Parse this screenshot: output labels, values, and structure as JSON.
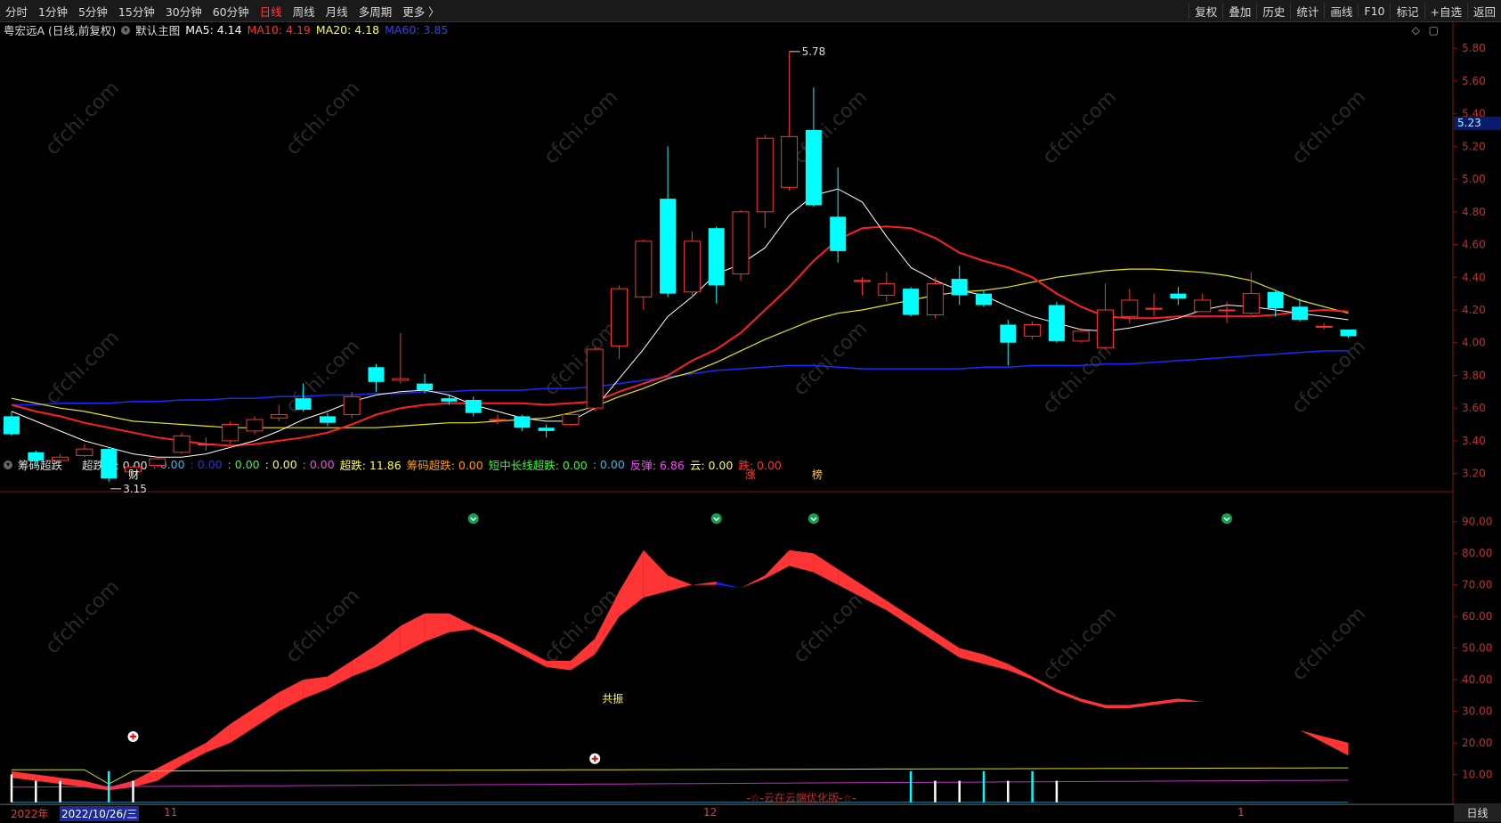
{
  "toolbar": {
    "periods": [
      "分时",
      "1分钟",
      "5分钟",
      "15分钟",
      "30分钟",
      "60分钟",
      "日线",
      "周线",
      "月线",
      "多周期",
      "更多 〉"
    ],
    "active_period": "日线",
    "right_buttons": [
      "复权",
      "叠加",
      "历史",
      "统计",
      "画线",
      "F10",
      "标记",
      "+自选",
      "返回"
    ]
  },
  "main_info": {
    "stock": "粤宏远A (日线,前复权)",
    "template": "默认主图",
    "ma5": "MA5: 4.14",
    "ma10": "MA10: 4.19",
    "ma20": "MA20: 4.18",
    "ma60": "MA60: 3.85"
  },
  "sub_info": {
    "name": "筹码超跌",
    "items": [
      {
        "text": "超跌柱: 0.00",
        "color": "#dddddd"
      },
      {
        "text": ": 0.00",
        "color": "#20c0ff"
      },
      {
        "text": ": 0.00",
        "color": "#2030ff"
      },
      {
        "text": ": 0.00",
        "color": "#30ff30"
      },
      {
        "text": ": 0.00",
        "color": "#ffff40"
      },
      {
        "text": ": 0.00",
        "color": "#ff40ff"
      },
      {
        "text": "超跌: 11.86",
        "color": "#ffff40"
      },
      {
        "text": "筹码超跌: 0.00",
        "color": "#ff9a00"
      },
      {
        "text": "短中长线超跌: 0.00",
        "color": "#30ff30"
      },
      {
        "text": ": 0.00",
        "color": "#20c0ff"
      },
      {
        "text": "反弹: 6.86",
        "color": "#ff40ff"
      },
      {
        "text": "云: 0.00",
        "color": "#ffff40"
      },
      {
        "text": "跌: 0.00",
        "color": "#ff3030"
      }
    ]
  },
  "colors": {
    "up": "#ff3232",
    "down": "#00ffff",
    "ma5": "#ffffff",
    "ma10": "#ff2020",
    "ma20": "#e8e800",
    "ma60": "#1a2aff",
    "axis": "#8a1010",
    "band_up": "#ff3535",
    "band_down": "#1a1aff"
  },
  "price_axis": {
    "min": 3.1,
    "max": 5.85,
    "labels": [
      "5.80",
      "5.60",
      "5.40",
      "5.20",
      "5.00",
      "4.80",
      "4.60",
      "4.40",
      "4.20",
      "4.00",
      "3.80",
      "3.60",
      "3.40",
      "3.20"
    ]
  },
  "current_price": "5.23",
  "sub_axis": {
    "min": 0,
    "max": 95,
    "labels": [
      "90.00",
      "80.00",
      "70.00",
      "60.00",
      "50.00",
      "40.00",
      "30.00",
      "20.00",
      "10.00"
    ]
  },
  "annotations": {
    "high": "5.78",
    "low": "3.15",
    "cai": "财",
    "zhang": "涨",
    "bang": "榜",
    "gongzhen": "共振",
    "watermark": "cfchi.com",
    "footer": "-☆-云在云端优化版-☆-"
  },
  "dates": {
    "year": "2022年",
    "cursor": "2022/10/26/三",
    "m11": "11",
    "m12": "12",
    "m1": "1"
  },
  "period_tag": "日线",
  "candles": [
    [
      3.55,
      3.44,
      3.58,
      3.43
    ],
    [
      3.33,
      3.28,
      3.34,
      3.24
    ],
    [
      3.28,
      3.3,
      3.32,
      3.27
    ],
    [
      3.31,
      3.35,
      3.38,
      3.3
    ],
    [
      3.35,
      3.17,
      3.36,
      3.15
    ],
    [
      3.21,
      3.24,
      3.25,
      3.19
    ],
    [
      3.25,
      3.29,
      3.3,
      3.24
    ],
    [
      3.33,
      3.43,
      3.45,
      3.32
    ],
    [
      3.38,
      3.38,
      3.42,
      3.34
    ],
    [
      3.4,
      3.5,
      3.52,
      3.38
    ],
    [
      3.46,
      3.53,
      3.55,
      3.44
    ],
    [
      3.54,
      3.56,
      3.62,
      3.52
    ],
    [
      3.66,
      3.59,
      3.75,
      3.58
    ],
    [
      3.55,
      3.51,
      3.57,
      3.49
    ],
    [
      3.56,
      3.67,
      3.7,
      3.54
    ],
    [
      3.85,
      3.76,
      3.87,
      3.7
    ],
    [
      3.77,
      3.78,
      4.06,
      3.75
    ],
    [
      3.75,
      3.71,
      3.81,
      3.69
    ],
    [
      3.66,
      3.64,
      3.68,
      3.62
    ],
    [
      3.65,
      3.57,
      3.67,
      3.55
    ],
    [
      3.53,
      3.53,
      3.56,
      3.5
    ],
    [
      3.55,
      3.48,
      3.56,
      3.46
    ],
    [
      3.48,
      3.46,
      3.5,
      3.42
    ],
    [
      3.5,
      3.56,
      3.58,
      3.49
    ],
    [
      3.6,
      3.96,
      3.97,
      3.58
    ],
    [
      3.98,
      4.33,
      4.35,
      3.9
    ],
    [
      4.28,
      4.62,
      4.63,
      4.2
    ],
    [
      4.88,
      4.3,
      5.2,
      4.28
    ],
    [
      4.31,
      4.62,
      4.68,
      4.27
    ],
    [
      4.7,
      4.35,
      4.71,
      4.24
    ],
    [
      4.42,
      4.8,
      4.81,
      4.38
    ],
    [
      4.8,
      5.25,
      5.27,
      4.7
    ],
    [
      4.95,
      5.26,
      5.78,
      4.93
    ],
    [
      5.3,
      4.84,
      5.56,
      4.83
    ],
    [
      4.77,
      4.56,
      5.07,
      4.49
    ],
    [
      4.38,
      4.38,
      4.4,
      4.29
    ],
    [
      4.29,
      4.36,
      4.43,
      4.25
    ],
    [
      4.33,
      4.17,
      4.34,
      4.16
    ],
    [
      4.17,
      4.36,
      4.4,
      4.15
    ],
    [
      4.39,
      4.29,
      4.47,
      4.23
    ],
    [
      4.3,
      4.23,
      4.32,
      4.22
    ],
    [
      4.11,
      4.0,
      4.14,
      3.86
    ],
    [
      4.04,
      4.11,
      4.13,
      4.02
    ],
    [
      4.23,
      4.01,
      4.25,
      4.0
    ],
    [
      4.01,
      4.07,
      4.09,
      4.0
    ],
    [
      3.97,
      4.2,
      4.36,
      3.96
    ],
    [
      4.16,
      4.26,
      4.33,
      4.12
    ],
    [
      4.21,
      4.21,
      4.3,
      4.16
    ],
    [
      4.3,
      4.27,
      4.34,
      4.23
    ],
    [
      4.19,
      4.26,
      4.3,
      4.19
    ],
    [
      4.2,
      4.2,
      4.25,
      4.12
    ],
    [
      4.18,
      4.3,
      4.43,
      4.17
    ],
    [
      4.31,
      4.21,
      4.32,
      4.16
    ],
    [
      4.22,
      4.14,
      4.27,
      4.13
    ],
    [
      4.1,
      4.1,
      4.12,
      4.08
    ],
    [
      4.08,
      4.04,
      4.08,
      4.03
    ]
  ],
  "ma5_series": [
    3.58,
    3.52,
    3.46,
    3.4,
    3.36,
    3.32,
    3.3,
    3.3,
    3.32,
    3.36,
    3.4,
    3.46,
    3.53,
    3.58,
    3.64,
    3.68,
    3.7,
    3.71,
    3.68,
    3.62,
    3.58,
    3.54,
    3.52,
    3.52,
    3.6,
    3.78,
    3.96,
    4.16,
    4.28,
    4.42,
    4.48,
    4.58,
    4.78,
    4.9,
    4.94,
    4.86,
    4.65,
    4.46,
    4.38,
    4.32,
    4.29,
    4.22,
    4.16,
    4.12,
    4.08,
    4.07,
    4.09,
    4.12,
    4.15,
    4.2,
    4.23,
    4.22,
    4.2,
    4.18,
    4.16,
    4.14
  ],
  "ma10_series": [
    3.62,
    3.58,
    3.55,
    3.51,
    3.48,
    3.45,
    3.42,
    3.4,
    3.38,
    3.37,
    3.38,
    3.4,
    3.42,
    3.45,
    3.5,
    3.56,
    3.6,
    3.62,
    3.63,
    3.63,
    3.63,
    3.63,
    3.62,
    3.63,
    3.64,
    3.7,
    3.75,
    3.8,
    3.89,
    3.96,
    4.06,
    4.2,
    4.34,
    4.5,
    4.63,
    4.7,
    4.71,
    4.7,
    4.64,
    4.55,
    4.5,
    4.46,
    4.4,
    4.3,
    4.22,
    4.16,
    4.15,
    4.15,
    4.16,
    4.16,
    4.16,
    4.16,
    4.17,
    4.19,
    4.2,
    4.19
  ],
  "ma20_series": [
    3.66,
    3.63,
    3.6,
    3.58,
    3.55,
    3.52,
    3.51,
    3.5,
    3.49,
    3.48,
    3.48,
    3.48,
    3.48,
    3.48,
    3.48,
    3.48,
    3.49,
    3.5,
    3.51,
    3.51,
    3.52,
    3.53,
    3.54,
    3.57,
    3.61,
    3.67,
    3.72,
    3.78,
    3.82,
    3.88,
    3.95,
    4.02,
    4.08,
    4.14,
    4.18,
    4.2,
    4.23,
    4.26,
    4.29,
    4.31,
    4.32,
    4.34,
    4.37,
    4.4,
    4.42,
    4.44,
    4.45,
    4.45,
    4.44,
    4.43,
    4.41,
    4.38,
    4.32,
    4.26,
    4.22,
    4.18
  ],
  "ma60_series": [
    3.62,
    3.62,
    3.63,
    3.63,
    3.63,
    3.64,
    3.64,
    3.65,
    3.65,
    3.66,
    3.66,
    3.67,
    3.67,
    3.68,
    3.68,
    3.69,
    3.69,
    3.7,
    3.7,
    3.71,
    3.71,
    3.71,
    3.72,
    3.72,
    3.73,
    3.75,
    3.77,
    3.79,
    3.81,
    3.83,
    3.84,
    3.85,
    3.86,
    3.86,
    3.85,
    3.84,
    3.84,
    3.84,
    3.84,
    3.84,
    3.85,
    3.85,
    3.86,
    3.86,
    3.86,
    3.87,
    3.87,
    3.88,
    3.89,
    3.9,
    3.91,
    3.92,
    3.93,
    3.94,
    3.95,
    3.95
  ],
  "band_a": [
    9,
    8,
    7,
    6,
    5,
    6,
    8,
    13,
    17,
    20,
    25,
    30,
    34,
    37,
    41,
    44,
    48,
    52,
    55,
    56,
    52,
    48,
    44,
    43,
    48,
    60,
    66,
    68,
    70,
    71,
    69,
    72,
    76,
    74,
    70,
    66,
    62,
    57,
    52,
    47,
    45,
    43,
    40,
    36,
    33,
    31,
    31,
    32,
    33,
    33,
    32,
    30,
    27,
    24,
    20,
    16
  ],
  "band_b": [
    11,
    10,
    9,
    8,
    6,
    8,
    12,
    16,
    20,
    26,
    31,
    36,
    40,
    41,
    46,
    51,
    57,
    61,
    61,
    57,
    54,
    50,
    46,
    46,
    53,
    68,
    81,
    73,
    70,
    70,
    69,
    73,
    81,
    80,
    75,
    70,
    65,
    60,
    55,
    50,
    48,
    45,
    41,
    37,
    34,
    32,
    32,
    33,
    34,
    33,
    32,
    30,
    27,
    24,
    22,
    20
  ],
  "markers": [
    {
      "i": 19,
      "y": 91
    },
    {
      "i": 29,
      "y": 91
    },
    {
      "i": 33,
      "y": 91
    },
    {
      "i": 50,
      "y": 91
    }
  ],
  "crosses": [
    {
      "i": 5,
      "y": 22
    },
    {
      "i": 24,
      "y": 15
    }
  ]
}
